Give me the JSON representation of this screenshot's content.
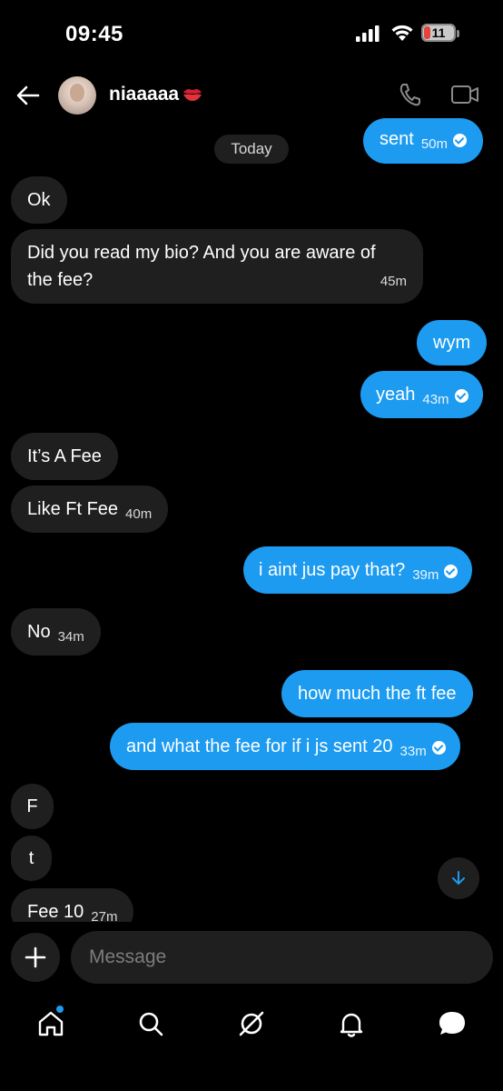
{
  "status_bar": {
    "time": "09:45",
    "battery": "11"
  },
  "header": {
    "username": "niaaaaa",
    "name_emoji": "kiss-mark-icon"
  },
  "date_divider": "Today",
  "messages": [
    {
      "dir": "out",
      "text": "sent",
      "time": "50m",
      "read": true
    },
    {
      "dir": "in",
      "text": "Ok",
      "time": ""
    },
    {
      "dir": "in",
      "text_line1": "Did you read my bio? And you are aware of",
      "text_line2": "the fee?",
      "time": "45m"
    },
    {
      "dir": "out",
      "text": "wym",
      "time": ""
    },
    {
      "dir": "out",
      "text": "yeah",
      "time": "43m",
      "read": true
    },
    {
      "dir": "in",
      "text": "It’s A Fee",
      "time": ""
    },
    {
      "dir": "in",
      "text": "Like Ft Fee",
      "time": "40m"
    },
    {
      "dir": "out",
      "text": "i aint jus pay that?",
      "time": "39m",
      "read": true
    },
    {
      "dir": "in",
      "text": "No",
      "time": "34m"
    },
    {
      "dir": "out",
      "text": "how much the ft fee",
      "time": ""
    },
    {
      "dir": "out",
      "text": "and what the fee for if i js sent 20",
      "time": "33m",
      "read": true
    },
    {
      "dir": "in",
      "text": "F",
      "time": ""
    },
    {
      "dir": "in",
      "text": "t",
      "time": ""
    },
    {
      "dir": "in",
      "text": "Fee 10",
      "time": "27m"
    }
  ],
  "composer": {
    "placeholder": "Message"
  },
  "colors": {
    "accent": "#1d9bf0",
    "incoming_bubble": "#1f1f1f",
    "background": "#000000"
  },
  "tabs": [
    "home-icon",
    "search-icon",
    "grok-icon",
    "notifications-icon",
    "messages-icon"
  ]
}
